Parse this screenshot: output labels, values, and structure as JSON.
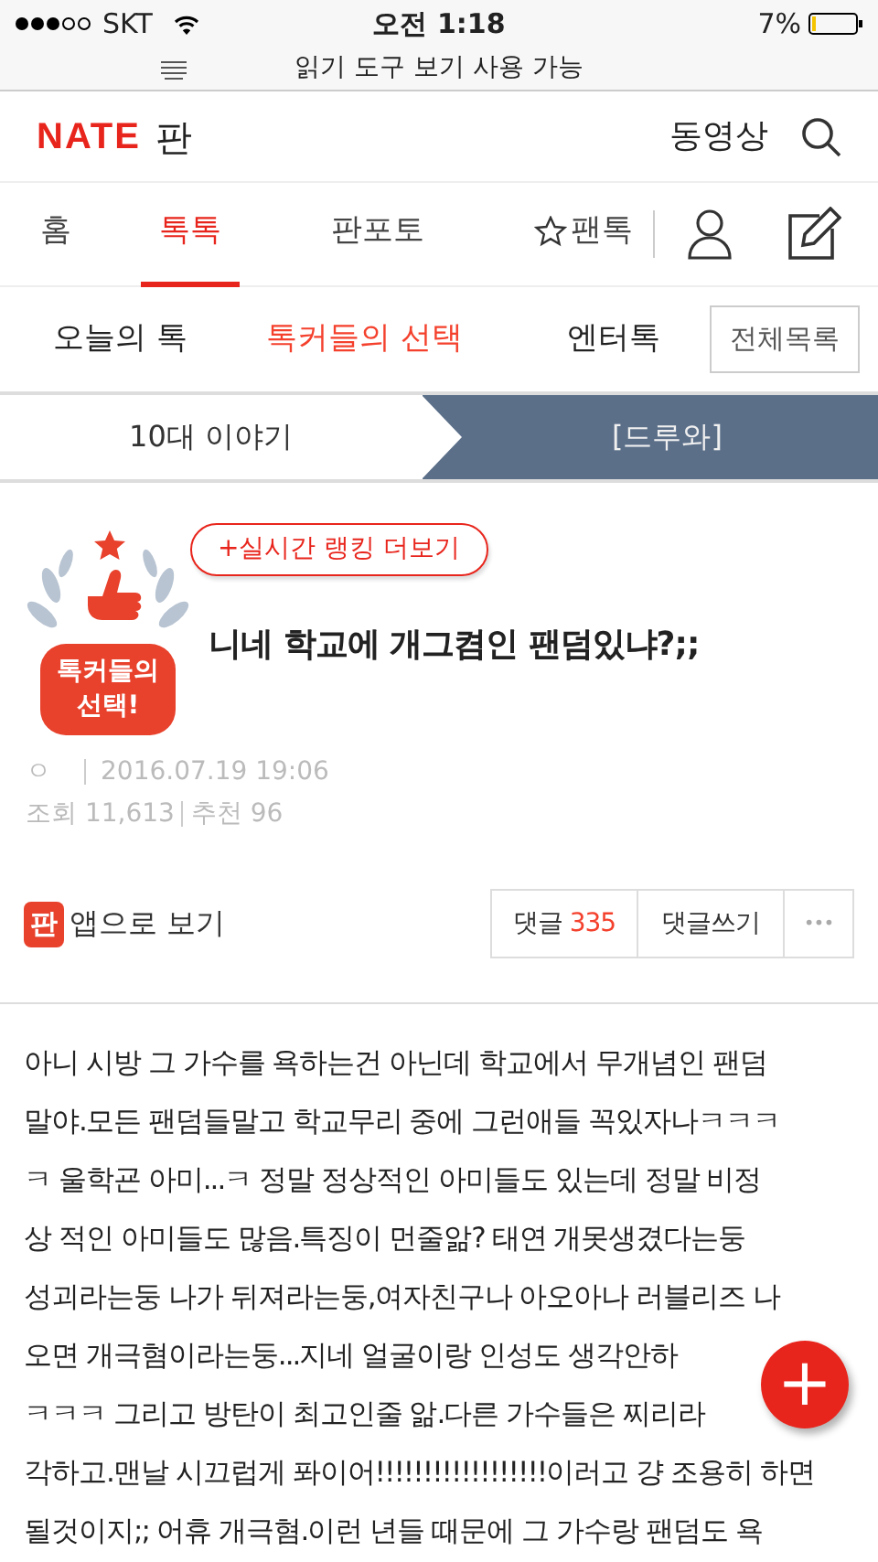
{
  "status_bar": {
    "carrier": "SKT",
    "time": "오전 1:18",
    "battery": "7%"
  },
  "reader_bar": {
    "text": "읽기 도구 보기 사용 가능"
  },
  "header": {
    "logo": "NATE",
    "logo_suffix": "판",
    "video_link": "동영상"
  },
  "main_tabs": [
    {
      "label": "홈",
      "selected": false,
      "star": false
    },
    {
      "label": "톡톡",
      "selected": true,
      "star": false
    },
    {
      "label": "판포토",
      "selected": false,
      "star": false
    },
    {
      "label": "팬톡",
      "selected": false,
      "star": true
    }
  ],
  "sub_tabs": [
    {
      "label": "오늘의 톡",
      "selected": false
    },
    {
      "label": "톡커들의 선택",
      "selected": true
    },
    {
      "label": "엔터톡",
      "selected": false
    }
  ],
  "all_list_button": "전체목록",
  "breadcrumb": [
    {
      "label": "10대 이야기",
      "selected": false
    },
    {
      "label": "[드루와]",
      "selected": true
    }
  ],
  "post": {
    "badge_text": [
      "톡커들의",
      "선택!"
    ],
    "ranking_button": "+실시간 랭킹 더보기",
    "title": "니네 학교에 개그켬인 팬덤있냐?;;",
    "author": "ㅇ",
    "date": "2016.07.19 19:06",
    "views_label": "조회",
    "views": "11,613",
    "recommend_label": "추천",
    "recommends": "96"
  },
  "actions": {
    "app_icon": "판",
    "app_view": "앱으로 보기",
    "comments_label": "댓글",
    "comments_count": "335",
    "write_comment": "댓글쓰기",
    "more": "•••"
  },
  "body_lines": [
    "아니 시방 그 가수를 욕하는건 아닌데 학교에서 무개념인 팬덤",
    "말야.모든 팬덤들말고 학교무리 중에 그런애들 꼭있자나ㅋㅋㅋ",
    "ㅋ 울학굔 아미...ㅋ 정말 정상적인 아미들도 있는데 정말 비정",
    "상 적인 아미들도 많음.특징이 먼줄앎? 태연 개못생겼다는둥",
    "성괴라는둥 나가 뒤져라는둥,여자친구나 아오아나 러블리즈 나",
    "오면 개극혐이라는둥...지네 얼굴이랑 인성도 생각안하",
    "ㅋㅋㅋ 그리고 방탄이 최고인줄 앎.다른 가수들은 찌리라",
    "각하고.맨날 시끄럽게 퐈이어!!!!!!!!!!!!!!!!!!이러고 걍 조용히 하면",
    "될것이지;; 어휴 개극혐.이런 년들 때문에 그 가수랑 팬덤도 욕"
  ],
  "fab": {
    "label": "+"
  }
}
